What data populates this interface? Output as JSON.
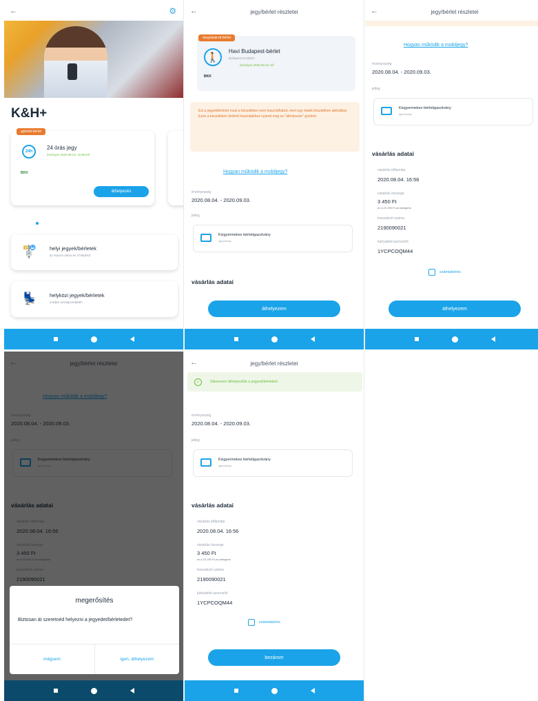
{
  "screen1": {
    "brand": "K&H+",
    "card_badge": "ajánlott bérlet",
    "card_icon": "24h",
    "card_title": "24 órás jegy",
    "card_valid": "érvényes 2020.08.04. 16:56-tól",
    "card_logo": "BKK",
    "card_button": "áthelyezés",
    "menu1_title": "helyi jegyek/bérletek",
    "menu1_sub": "az összes város és 4 helyközi",
    "menu2_title": "helyközi jegyek/bérletek",
    "menu2_sub": "a teljes ország területén"
  },
  "detail": {
    "title": "jegy/bérlet részletei",
    "badge": "megvásárolt bérlet",
    "ticket_name": "Havi Budapest-bérlet",
    "ticket_sub": "Budapest területén",
    "ticket_valid": "érvényes 2020.08.04.-tól",
    "ticket_logo": "BKK",
    "warning": "Ezt a jegyet/bérletet most a készüléken nem használhatod, mert egy másik készüléken aktiváltad. Ezen a készüléken történő használathoz nyomd meg az \"áthelyezés\" gombot.",
    "how_link": "Hogyan működik a mobiljegy?",
    "validity_label": "érvényesség",
    "validity_value": "2020.08.04. - 2020.09.03.",
    "type_label": "jelleg",
    "type_name": "Kisgyermekes bérletigazolvány",
    "type_sub": "igazolvány",
    "purchase_section": "vásárlás adatai",
    "purchase_time_label": "vásárlás időpontja",
    "purchase_time": "2020.08.04. 16:56",
    "purchase_amount_label": "vásárlás összege",
    "purchase_amount": "3 450 Ft",
    "purchase_amount_note": "ez a 23 250 Ft-os kategória",
    "order_label": "tranzakció száma",
    "order_id": "2190090021",
    "barcode_label": "kártyakód azonosító",
    "barcode_id": "1YCPCOQM44",
    "invoice": "számlakérés",
    "move_button": "áthelyezem"
  },
  "dialog": {
    "title": "megerősítés",
    "message": "Biztosan át szeretnéd helyezni a jegyedet/bérletedet?",
    "cancel": "mégsem",
    "confirm": "igen, áthelyezem"
  },
  "screen5": {
    "toast": "Sikeresen áthelyeztük a jegyed/bérleted.",
    "done_button": "bezárom"
  },
  "colors": {
    "accent": "#1aa3e8",
    "warning_text": "#e0762a",
    "success": "#6cbf3a",
    "badge": "#e87a2e"
  }
}
